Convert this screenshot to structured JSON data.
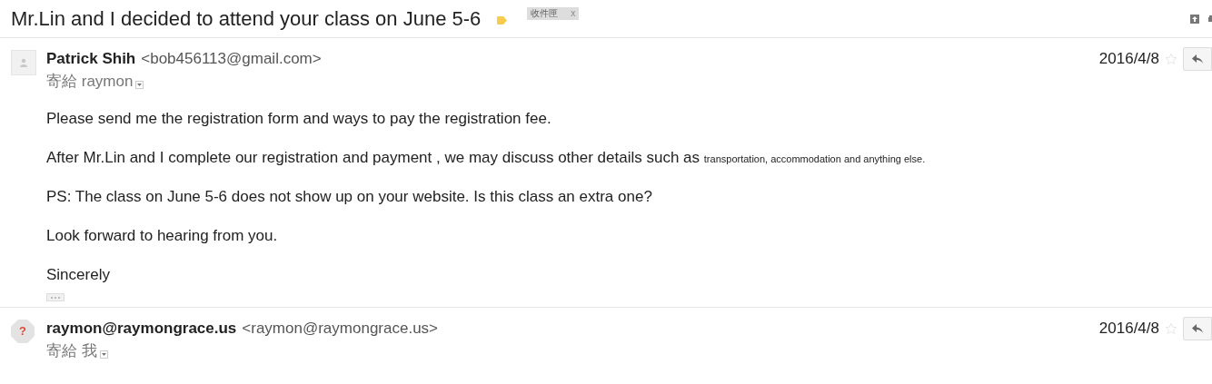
{
  "subject": "Mr.Lin and I decided to attend your class on June 5-6",
  "label": {
    "text": "收件匣",
    "remove": "x"
  },
  "messages": [
    {
      "sender": "Patrick Shih",
      "email": "<bob456113@gmail.com>",
      "to": "寄給 raymon",
      "date": "2016/4/8",
      "starred": false,
      "body": [
        {
          "text": "Please send me the registration form and ways to pay the registration fee."
        },
        {
          "text": "After Mr.Lin and I complete our registration and payment , we may discuss other details such as",
          "small": "transportation, accommodation and anything else."
        },
        {
          "text": "PS: The class on June 5-6 does not show up on your website. Is this class an extra one?"
        },
        {
          "text": "Look forward to hearing from you."
        },
        {
          "text": "Sincerely"
        }
      ],
      "trimmed": true
    },
    {
      "avatar_mark": "?",
      "sender": "raymon@raymongrace.us",
      "email": "<raymon@raymongrace.us>",
      "to": "寄給 我",
      "date": "2016/4/8",
      "starred": false
    }
  ]
}
